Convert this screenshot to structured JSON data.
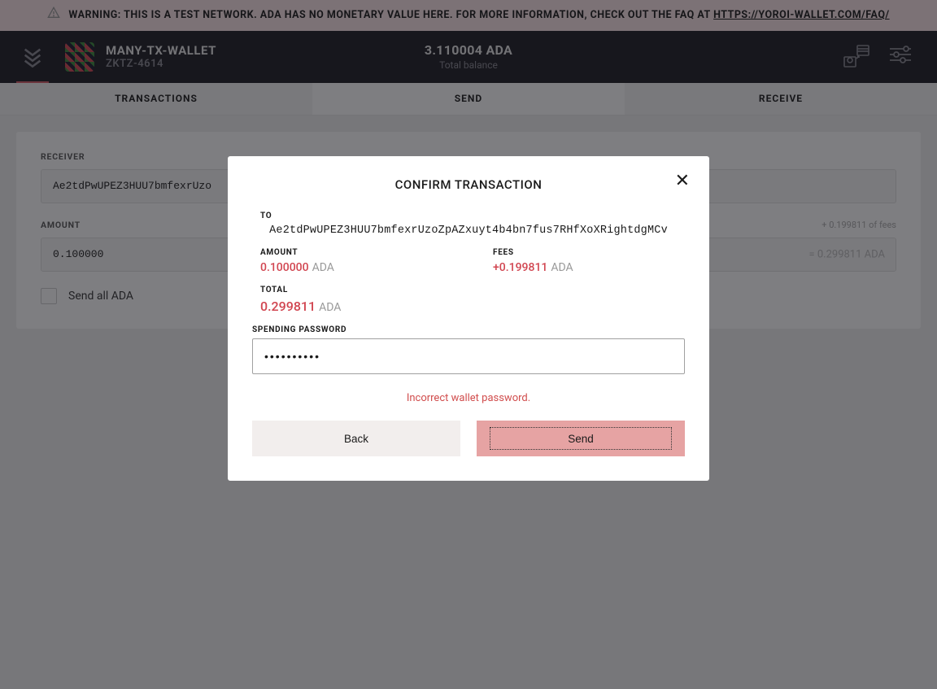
{
  "warning": {
    "text": "WARNING: THIS IS A TEST NETWORK. ADA HAS NO MONETARY VALUE HERE. FOR MORE INFORMATION, CHECK OUT THE FAQ AT ",
    "link_text": "HTTPS://YOROI-WALLET.COM/FAQ/"
  },
  "header": {
    "wallet_name": "MANY-TX-WALLET",
    "wallet_id": "ZKTZ-4614",
    "balance": "3.110004 ADA",
    "balance_label": "Total balance"
  },
  "tabs": {
    "transactions": "TRANSACTIONS",
    "send": "SEND",
    "receive": "RECEIVE"
  },
  "form": {
    "receiver_label": "RECEIVER",
    "receiver_value": "Ae2tdPwUPEZ3HUU7bmfexrUzo",
    "amount_label": "AMOUNT",
    "amount_value": "0.100000",
    "fees_hint": "+ 0.199811 of fees",
    "amount_total": "= 0.299811 ADA",
    "send_all_label": "Send all ADA"
  },
  "modal": {
    "title": "CONFIRM TRANSACTION",
    "to_label": "TO",
    "to_address": "Ae2tdPwUPEZ3HUU7bmfexrUzoZpAZxuyt4b4bn7fus7RHfXoXRightdgMCv",
    "amount_label": "AMOUNT",
    "amount_value": "0.100000",
    "amount_currency": "ADA",
    "fees_label": "FEES",
    "fees_value": "+0.199811",
    "fees_currency": "ADA",
    "total_label": "TOTAL",
    "total_value": "0.299811",
    "total_currency": "ADA",
    "password_label": "SPENDING PASSWORD",
    "password_value": "••••••••••",
    "error": "Incorrect wallet password.",
    "back_label": "Back",
    "send_label": "Send"
  }
}
